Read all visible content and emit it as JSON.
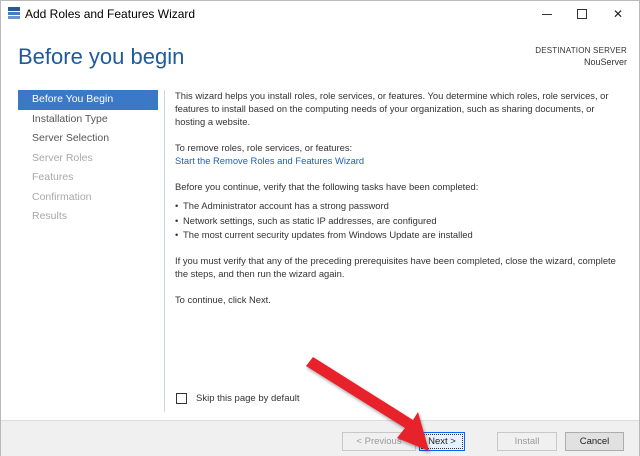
{
  "window": {
    "title": "Add Roles and Features Wizard"
  },
  "header": {
    "title": "Before you begin",
    "destination_label": "DESTINATION SERVER",
    "destination_server": "NouServer"
  },
  "nav": {
    "items": [
      {
        "label": "Before You Begin",
        "state": "active"
      },
      {
        "label": "Installation Type",
        "state": "enabled"
      },
      {
        "label": "Server Selection",
        "state": "enabled"
      },
      {
        "label": "Server Roles",
        "state": "disabled"
      },
      {
        "label": "Features",
        "state": "disabled"
      },
      {
        "label": "Confirmation",
        "state": "disabled"
      },
      {
        "label": "Results",
        "state": "disabled"
      }
    ]
  },
  "content": {
    "intro": "This wizard helps you install roles, role services, or features. You determine which roles, role services, or features to install based on the computing needs of your organization, such as sharing documents, or hosting a website.",
    "remove_label": "To remove roles, role services, or features:",
    "remove_link": "Start the Remove Roles and Features Wizard",
    "verify_intro": "Before you continue, verify that the following tasks have been completed:",
    "tasks": [
      "The Administrator account has a strong password",
      "Network settings, such as static IP addresses, are configured",
      "The most current security updates from Windows Update are installed"
    ],
    "prereq_note": "If you must verify that any of the preceding prerequisites have been completed, close the wizard, complete the steps, and then run the wizard again.",
    "continue_note": "To continue, click Next."
  },
  "skip": {
    "label": "Skip this page by default",
    "checked": false
  },
  "footer": {
    "previous_label": "< Previous",
    "next_label": "Next >",
    "install_label": "Install",
    "cancel_label": "Cancel"
  },
  "colors": {
    "accent": "#3b78c6",
    "title_blue": "#1e5a9c",
    "link_blue": "#1f62ad",
    "annotation_arrow": "#e8202a"
  }
}
